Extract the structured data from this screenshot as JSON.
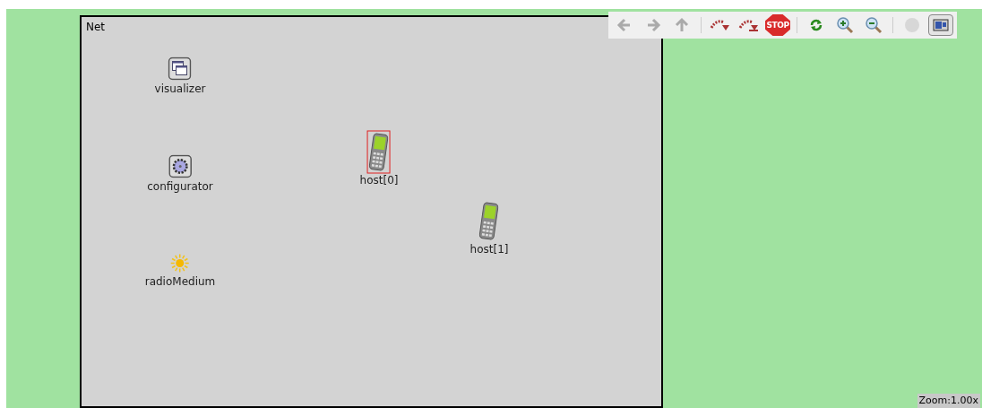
{
  "network": {
    "title": "Net",
    "nodes": [
      {
        "name": "visualizer",
        "kind": "window",
        "selected": false
      },
      {
        "name": "configurator",
        "kind": "gear",
        "selected": false
      },
      {
        "name": "radioMedium",
        "kind": "sun",
        "selected": false
      },
      {
        "name": "host[0]",
        "kind": "phone",
        "selected": true
      },
      {
        "name": "host[1]",
        "kind": "phone",
        "selected": false
      }
    ]
  },
  "toolbar": [
    {
      "kind": "back",
      "disabled": true
    },
    {
      "kind": "forward",
      "disabled": true
    },
    {
      "kind": "up",
      "disabled": true
    },
    {
      "kind": "separator"
    },
    {
      "kind": "step",
      "disabled": false
    },
    {
      "kind": "step-out",
      "disabled": false
    },
    {
      "kind": "stop",
      "label": "STOP",
      "disabled": false
    },
    {
      "kind": "separator"
    },
    {
      "kind": "relayout",
      "disabled": false
    },
    {
      "kind": "zoom-in",
      "disabled": false
    },
    {
      "kind": "zoom-out",
      "disabled": false
    },
    {
      "kind": "separator"
    },
    {
      "kind": "animation",
      "disabled": true
    },
    {
      "kind": "layout",
      "selected": true
    }
  ],
  "status": "Zoom:1.00x"
}
